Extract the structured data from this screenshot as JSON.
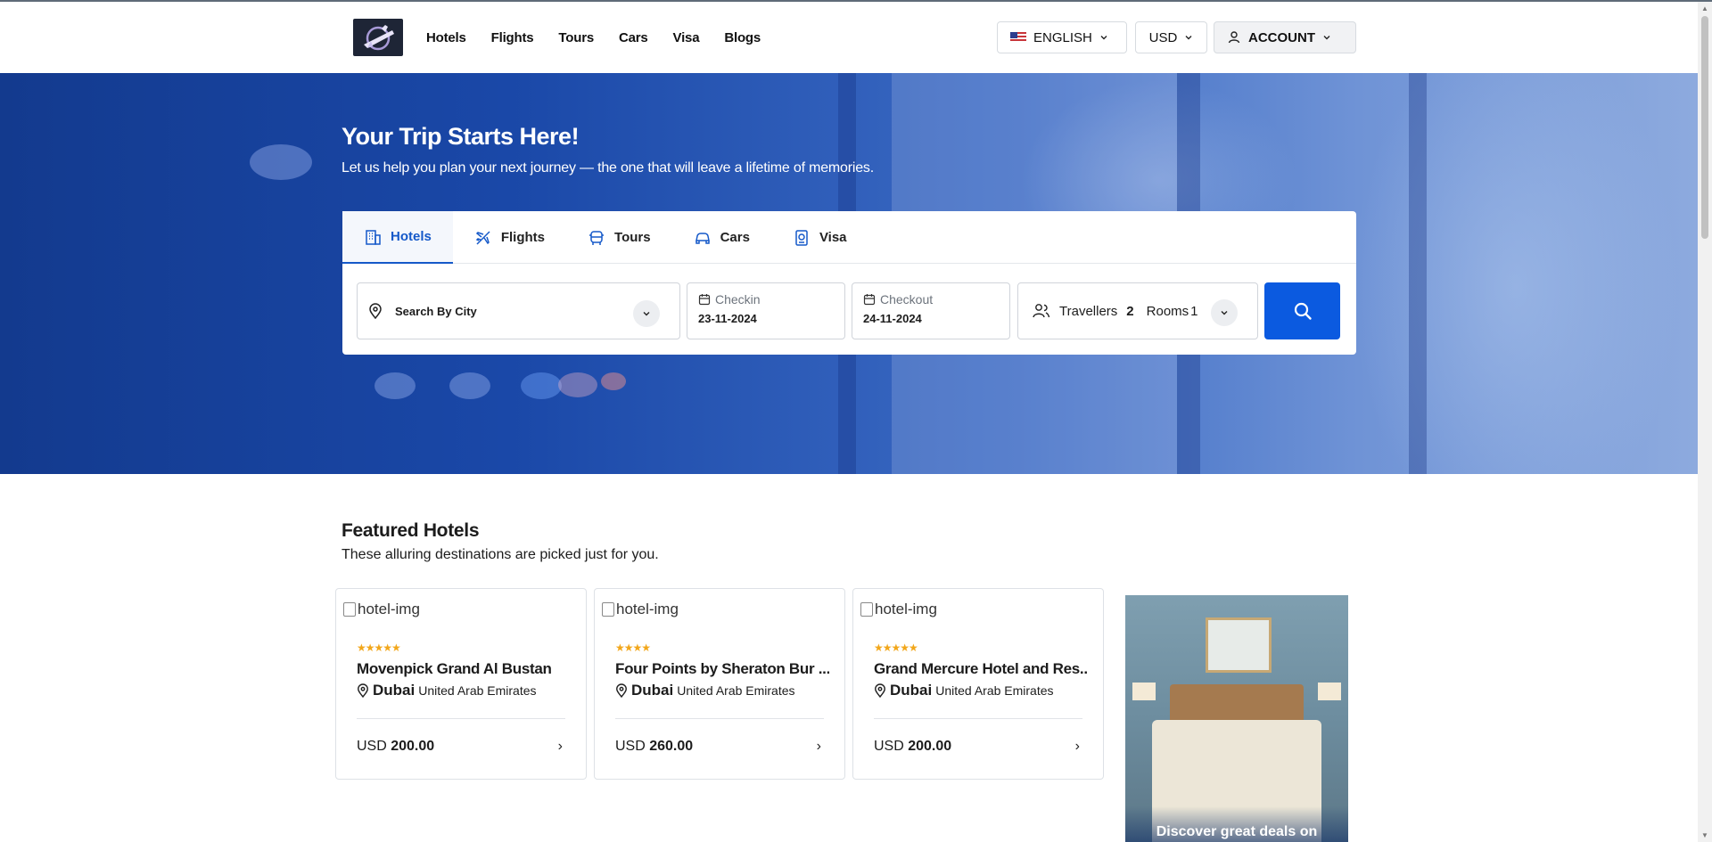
{
  "header": {
    "nav": [
      "Hotels",
      "Flights",
      "Tours",
      "Cars",
      "Visa",
      "Blogs"
    ],
    "language": "ENGLISH",
    "currency": "USD",
    "account": "ACCOUNT"
  },
  "hero": {
    "title": "Your Trip Starts Here!",
    "subtitle": "Let us help you plan your next journey — the one that will leave a lifetime of memories."
  },
  "search": {
    "tabs": [
      {
        "label": "Hotels",
        "icon": "building-icon",
        "active": true
      },
      {
        "label": "Flights",
        "icon": "plane-icon",
        "active": false
      },
      {
        "label": "Tours",
        "icon": "bus-icon",
        "active": false
      },
      {
        "label": "Cars",
        "icon": "car-icon",
        "active": false
      },
      {
        "label": "Visa",
        "icon": "passport-icon",
        "active": false
      }
    ],
    "city_placeholder": "Search By City",
    "checkin_label": "Checkin",
    "checkin_value": "23-11-2024",
    "checkout_label": "Checkout",
    "checkout_value": "24-11-2024",
    "travellers_label": "Travellers",
    "travellers_value": "2",
    "rooms_label": "Rooms",
    "rooms_value": "1"
  },
  "featured": {
    "title": "Featured Hotels",
    "subtitle": "These alluring destinations are picked just for you.",
    "hotels": [
      {
        "img_alt": "hotel-img",
        "stars": 5,
        "name": "Movenpick Grand Al Bustan",
        "city": "Dubai",
        "country": "United Arab Emirates",
        "currency": "USD",
        "price": "200.00"
      },
      {
        "img_alt": "hotel-img",
        "stars": 4,
        "name": "Four Points by Sheraton Bur ...",
        "city": "Dubai",
        "country": "United Arab Emirates",
        "currency": "USD",
        "price": "260.00"
      },
      {
        "img_alt": "hotel-img",
        "stars": 5,
        "name": "Grand Mercure Hotel and Res...",
        "city": "Dubai",
        "country": "United Arab Emirates",
        "currency": "USD",
        "price": "200.00"
      }
    ],
    "promo_text": "Discover great deals on"
  },
  "colors": {
    "accent": "#0b5ae0",
    "tab_active": "#1559c9",
    "star": "#f2a71b"
  }
}
